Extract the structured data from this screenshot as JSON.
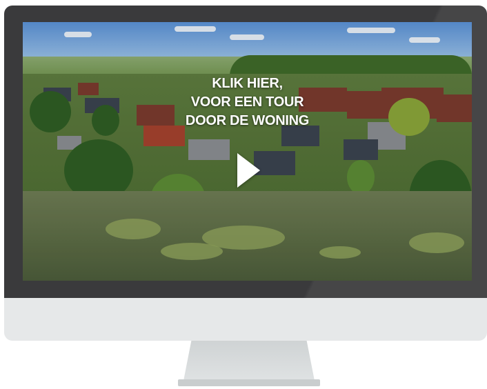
{
  "video": {
    "cta_lines": [
      "KLIK HIER,",
      "VOOR EEN TOUR",
      "DOOR DE WONING"
    ],
    "play_icon": "play-icon"
  },
  "colors": {
    "bezel": "#3a3a3c",
    "chin": "#e6e8e9",
    "stand": "#d4d7d8",
    "overlay_text": "#ffffff"
  }
}
